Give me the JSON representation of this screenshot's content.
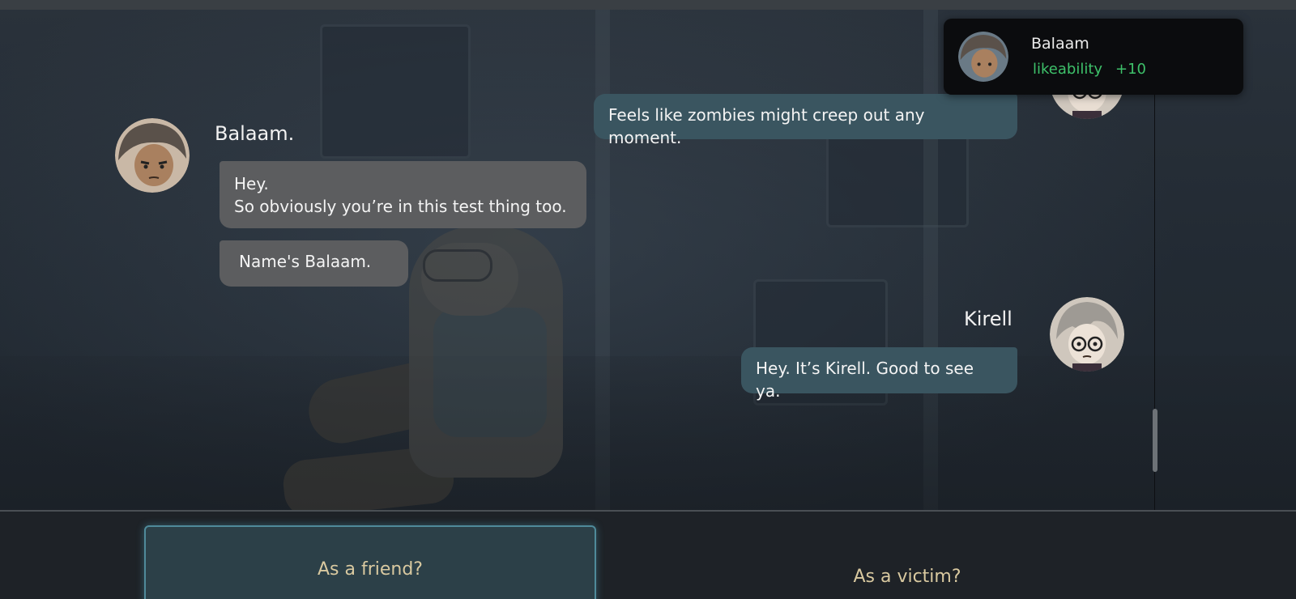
{
  "notification": {
    "name": "Balaam",
    "stat": "likeability",
    "value": "+10",
    "avatar_icon": "balaam-portrait-icon"
  },
  "messages": {
    "top_right": {
      "text": "Feels like zombies might creep out any moment."
    },
    "balaam": {
      "speaker": "Balaam.",
      "line1": "Hey.",
      "line2": "So obviously you’re in this test thing too.",
      "line3": "Name's Balaam."
    },
    "kirell": {
      "speaker": "Kirell",
      "line1": "Hey. It’s Kirell. Good to see ya."
    }
  },
  "choices": [
    {
      "label": "As a friend?",
      "selected": true
    },
    {
      "label": "As a victim?",
      "selected": false
    }
  ],
  "colors": {
    "npc_bubble": "#5c5d5f",
    "player_bubble": "#3a5560",
    "stat_green": "#3ec16a",
    "choice_text": "#d9c9a0",
    "choice_border": "#4f8a9a"
  }
}
